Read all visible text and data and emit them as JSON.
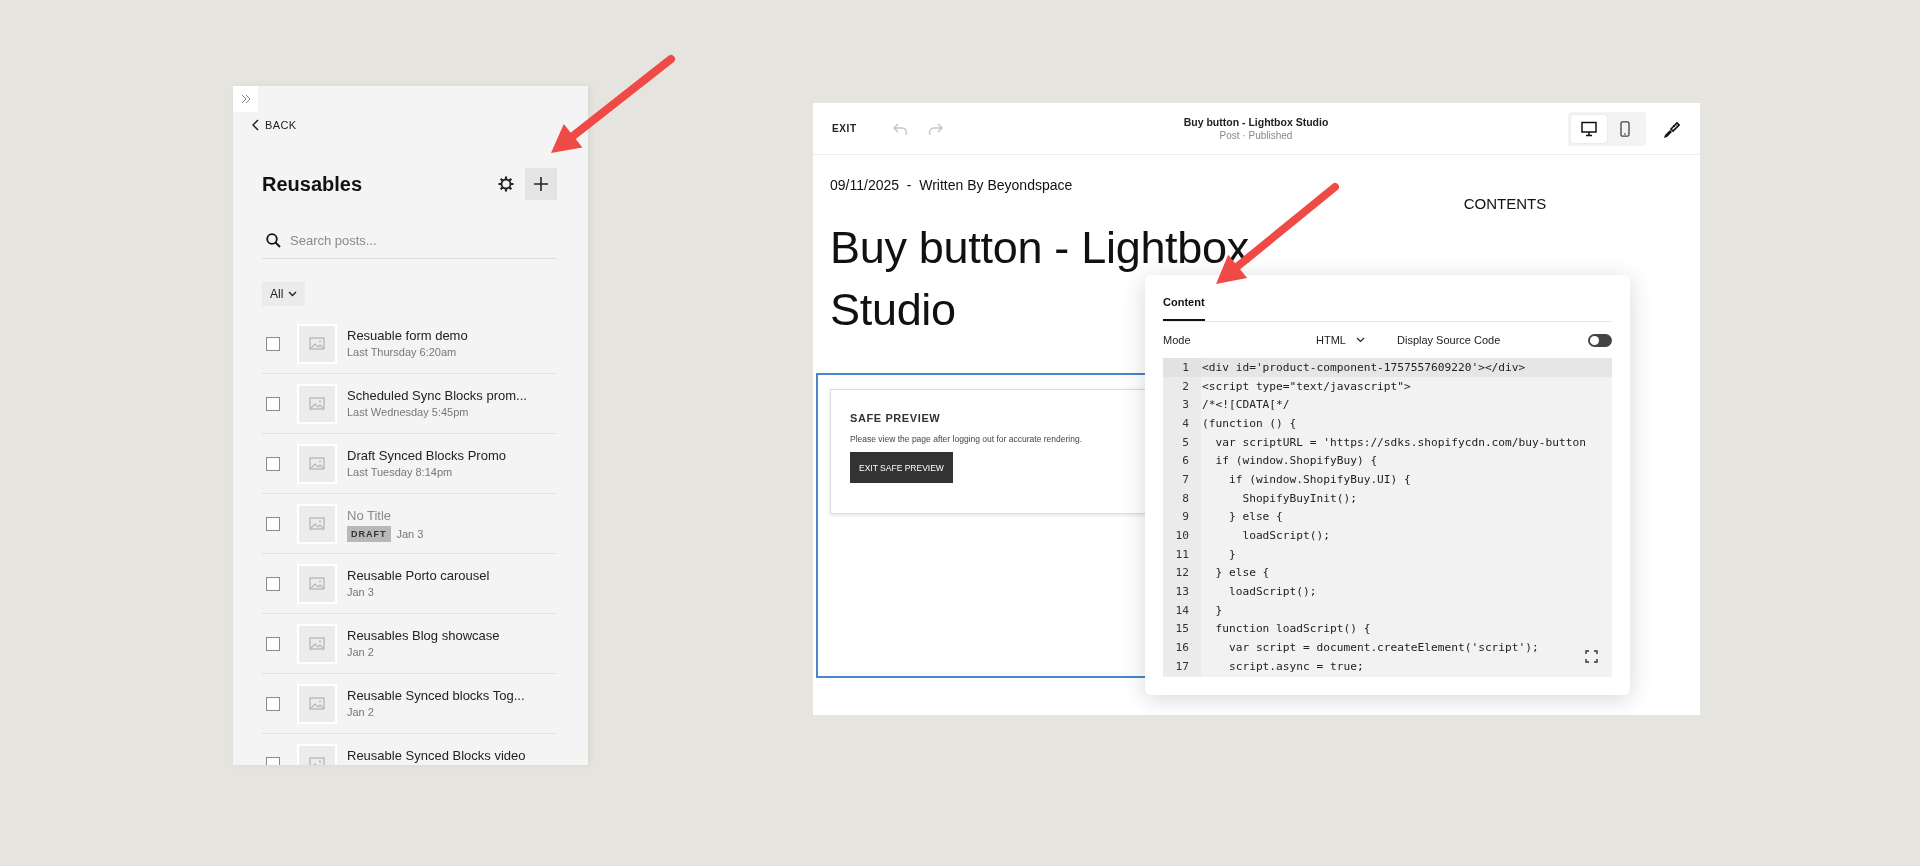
{
  "left_panel": {
    "back": "BACK",
    "title": "Reusables",
    "search": {
      "placeholder": "Search posts..."
    },
    "filter": "All",
    "posts": [
      {
        "title": "Resuable form demo",
        "date": "Last Thursday 6:20am",
        "checked": false,
        "untitled": false
      },
      {
        "title": "Scheduled Sync Blocks prom...",
        "date": "Last Wednesday 5:45pm",
        "checked": false,
        "untitled": false
      },
      {
        "title": "Draft Synced Blocks Promo",
        "date": "Last Tuesday 8:14pm",
        "checked": false,
        "untitled": false
      },
      {
        "title": "No Title",
        "badge": "DRAFT",
        "date": "Jan 3",
        "checked": false,
        "untitled": true
      },
      {
        "title": "Reusable Porto carousel",
        "date": "Jan 3",
        "checked": false,
        "untitled": false
      },
      {
        "title": "Reusables Blog showcase",
        "date": "Jan 2",
        "checked": false,
        "untitled": false
      },
      {
        "title": "Reusable Synced blocks Tog...",
        "date": "Jan 2",
        "checked": false,
        "untitled": false
      },
      {
        "title": "Reusable Synced Blocks video",
        "checked": false,
        "untitled": false
      }
    ]
  },
  "editor": {
    "exit": "EXIT",
    "title": "Buy button - Lightbox Studio",
    "subtitle": "Post · Published",
    "devices": [
      {
        "kind": "desktop",
        "selected": true
      },
      {
        "kind": "mobile",
        "selected": false
      }
    ],
    "byline": "09/11/2025  -  Written By Beyondspace",
    "heading_lines": [
      "Buy button - Lightbox",
      "Studio"
    ],
    "contents_title": "CONTENTS",
    "safe_preview": {
      "title": "SAFE PREVIEW",
      "message": "Please view the page after logging out for accurate rendering.",
      "button": "EXIT SAFE PREVIEW"
    },
    "popup": {
      "tabs": [
        {
          "label": "Content",
          "selected": true
        }
      ],
      "mode_label": "Mode",
      "mode_value": "HTML",
      "source_label": "Display Source Code",
      "source_on": false,
      "code": [
        {
          "number": "1",
          "text": "<div id='product-component-1757557609220'></div>",
          "active": true
        },
        {
          "number": "2",
          "text": "<script type=\"text/javascript\">",
          "active": false
        },
        {
          "number": "3",
          "text": "/*<![CDATA[*/",
          "active": false
        },
        {
          "number": "4",
          "text": "(function () {",
          "active": false
        },
        {
          "number": "5",
          "text": "  var scriptURL = 'https://sdks.shopifycdn.com/buy-button",
          "active": false
        },
        {
          "number": "6",
          "text": "  if (window.ShopifyBuy) {",
          "active": false
        },
        {
          "number": "7",
          "text": "    if (window.ShopifyBuy.UI) {",
          "active": false
        },
        {
          "number": "8",
          "text": "      ShopifyBuyInit();",
          "active": false
        },
        {
          "number": "9",
          "text": "    } else {",
          "active": false
        },
        {
          "number": "10",
          "text": "      loadScript();",
          "active": false
        },
        {
          "number": "11",
          "text": "    }",
          "active": false
        },
        {
          "number": "12",
          "text": "  } else {",
          "active": false
        },
        {
          "number": "13",
          "text": "    loadScript();",
          "active": false
        },
        {
          "number": "14",
          "text": "  }",
          "active": false
        },
        {
          "number": "15",
          "text": "  function loadScript() {",
          "active": false
        },
        {
          "number": "16",
          "text": "    var script = document.createElement('script');",
          "active": false
        },
        {
          "number": "17",
          "text": "    script.async = true;",
          "active": false
        }
      ]
    }
  }
}
